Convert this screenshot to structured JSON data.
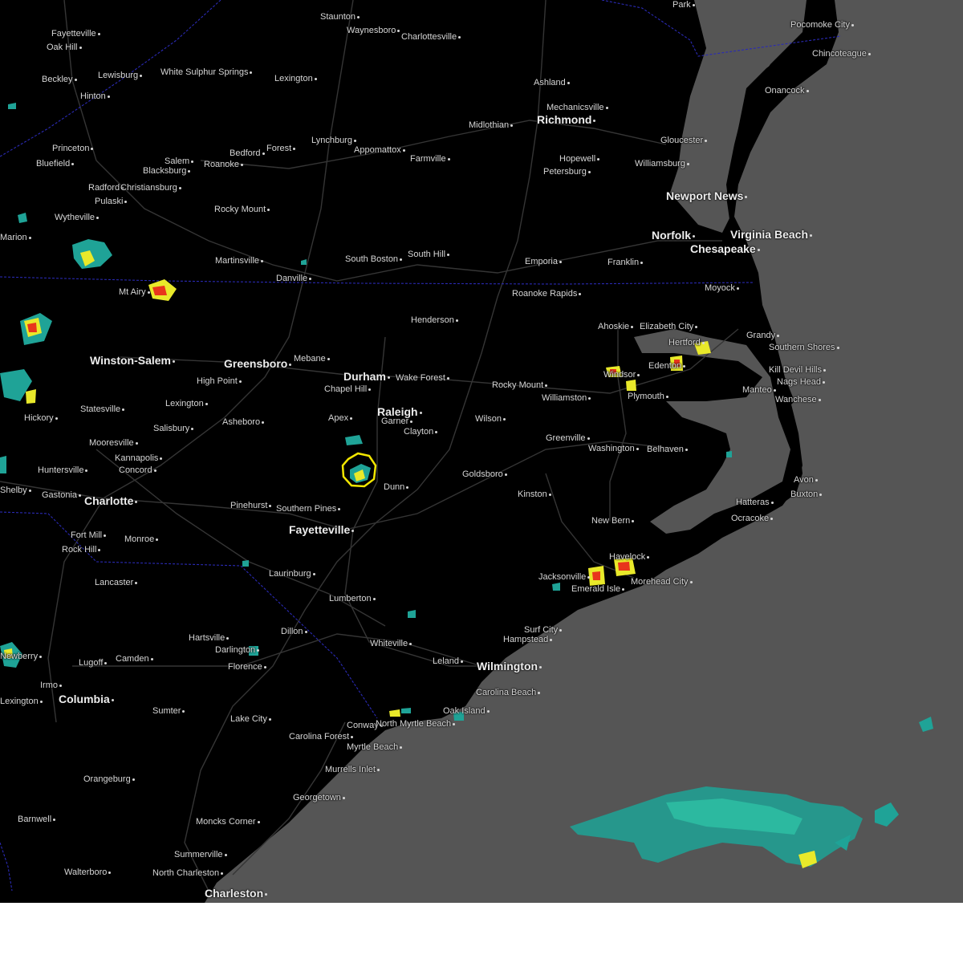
{
  "colors": {
    "land": "#000000",
    "ocean": "#555555",
    "roads": "#3a3a3a",
    "state_borders": "#2a2ab5",
    "label": "#d6d6d6",
    "warning_polygon": "#f2e600",
    "radar_light": "#2ab3a0",
    "radar_moderate": "#e9e92a",
    "radar_heavy": "#e8351c"
  },
  "map": {
    "warning_polygon_label": "",
    "cities": [
      {
        "name": "Staunton"
      },
      {
        "name": "Waynesboro"
      },
      {
        "name": "Charlottesville"
      },
      {
        "name": "Fayetteville"
      },
      {
        "name": "Oak Hill"
      },
      {
        "name": "Beckley"
      },
      {
        "name": "Lewisburg"
      },
      {
        "name": "White Sulphur Springs"
      },
      {
        "name": "Lexington"
      },
      {
        "name": "Hinton"
      },
      {
        "name": "Ashland"
      },
      {
        "name": "Mechanicsville"
      },
      {
        "name": "Midlothian"
      },
      {
        "name": "Richmond"
      },
      {
        "name": "Park"
      },
      {
        "name": "Pocomoke City"
      },
      {
        "name": "Chincoteague"
      },
      {
        "name": "Onancock"
      },
      {
        "name": "Princeton"
      },
      {
        "name": "Lynchburg"
      },
      {
        "name": "Bedford"
      },
      {
        "name": "Forest"
      },
      {
        "name": "Appomattox"
      },
      {
        "name": "Salem"
      },
      {
        "name": "Roanoke"
      },
      {
        "name": "Bluefield"
      },
      {
        "name": "Blacksburg"
      },
      {
        "name": "Farmville"
      },
      {
        "name": "Hopewell"
      },
      {
        "name": "Petersburg"
      },
      {
        "name": "Gloucester"
      },
      {
        "name": "Williamsburg"
      },
      {
        "name": "Radford"
      },
      {
        "name": "Christiansburg"
      },
      {
        "name": "Pulaski"
      },
      {
        "name": "Newport News"
      },
      {
        "name": "Rocky Mount"
      },
      {
        "name": "Wytheville"
      },
      {
        "name": "Marion"
      },
      {
        "name": "Norfolk"
      },
      {
        "name": "Virginia Beach"
      },
      {
        "name": "Chesapeake"
      },
      {
        "name": "Martinsville"
      },
      {
        "name": "South Boston"
      },
      {
        "name": "South Hill"
      },
      {
        "name": "Emporia"
      },
      {
        "name": "Franklin"
      },
      {
        "name": "Danville"
      },
      {
        "name": "Mt Airy"
      },
      {
        "name": "Moyock"
      },
      {
        "name": "Roanoke Rapids"
      },
      {
        "name": "Henderson"
      },
      {
        "name": "Ahoskie"
      },
      {
        "name": "Elizabeth City"
      },
      {
        "name": "Grandy"
      },
      {
        "name": "Hertford"
      },
      {
        "name": "Southern Shores"
      },
      {
        "name": "Kill Devil Hills"
      },
      {
        "name": "Nags Head"
      },
      {
        "name": "Edenton"
      },
      {
        "name": "Winston-Salem"
      },
      {
        "name": "Greensboro"
      },
      {
        "name": "Mebane"
      },
      {
        "name": "Durham"
      },
      {
        "name": "Wake Forest"
      },
      {
        "name": "Rocky Mount"
      },
      {
        "name": "Windsor"
      },
      {
        "name": "Plymouth"
      },
      {
        "name": "Manteo"
      },
      {
        "name": "Wanchese"
      },
      {
        "name": "High Point"
      },
      {
        "name": "Chapel Hill"
      },
      {
        "name": "Williamston"
      },
      {
        "name": "Lexington"
      },
      {
        "name": "Statesville"
      },
      {
        "name": "Hickory"
      },
      {
        "name": "Raleigh"
      },
      {
        "name": "Apex"
      },
      {
        "name": "Garner"
      },
      {
        "name": "Asheboro"
      },
      {
        "name": "Wilson"
      },
      {
        "name": "Salisbury"
      },
      {
        "name": "Clayton"
      },
      {
        "name": "Greenville"
      },
      {
        "name": "Mooresville"
      },
      {
        "name": "Washington"
      },
      {
        "name": "Belhaven"
      },
      {
        "name": "Kannapolis"
      },
      {
        "name": "Huntersville"
      },
      {
        "name": "Concord"
      },
      {
        "name": "Goldsboro"
      },
      {
        "name": "Avon"
      },
      {
        "name": "Dunn"
      },
      {
        "name": "Shelby"
      },
      {
        "name": "Gastonia"
      },
      {
        "name": "Kinston"
      },
      {
        "name": "Buxton"
      },
      {
        "name": "Hatteras"
      },
      {
        "name": "Charlotte"
      },
      {
        "name": "Pinehurst"
      },
      {
        "name": "Southern Pines"
      },
      {
        "name": "Ocracoke"
      },
      {
        "name": "New Bern"
      },
      {
        "name": "Fayetteville"
      },
      {
        "name": "Fort Mill"
      },
      {
        "name": "Monroe"
      },
      {
        "name": "Rock Hill"
      },
      {
        "name": "Havelock"
      },
      {
        "name": "Jacksonville"
      },
      {
        "name": "Laurinburg"
      },
      {
        "name": "Morehead City"
      },
      {
        "name": "Lancaster"
      },
      {
        "name": "Emerald Isle"
      },
      {
        "name": "Lumberton"
      },
      {
        "name": "Surf City"
      },
      {
        "name": "Hampstead"
      },
      {
        "name": "Hartsville"
      },
      {
        "name": "Dillon"
      },
      {
        "name": "Darlington"
      },
      {
        "name": "Whiteville"
      },
      {
        "name": "Lugoff"
      },
      {
        "name": "Camden"
      },
      {
        "name": "Florence"
      },
      {
        "name": "Leland"
      },
      {
        "name": "Wilmington"
      },
      {
        "name": "Irmo"
      },
      {
        "name": "Columbia"
      },
      {
        "name": "Carolina Beach"
      },
      {
        "name": "Lexington"
      },
      {
        "name": "Sumter"
      },
      {
        "name": "Lake City"
      },
      {
        "name": "Conway"
      },
      {
        "name": "North Myrtle Beach"
      },
      {
        "name": "Oak Island"
      },
      {
        "name": "Carolina Forest"
      },
      {
        "name": "Myrtle Beach"
      },
      {
        "name": "Orangeburg"
      },
      {
        "name": "Murrells Inlet"
      },
      {
        "name": "Georgetown"
      },
      {
        "name": "Barnwell"
      },
      {
        "name": "Moncks Corner"
      },
      {
        "name": "Summerville"
      },
      {
        "name": "Walterboro"
      },
      {
        "name": "North Charleston"
      },
      {
        "name": "Charleston"
      },
      {
        "name": "Newberry"
      }
    ]
  }
}
